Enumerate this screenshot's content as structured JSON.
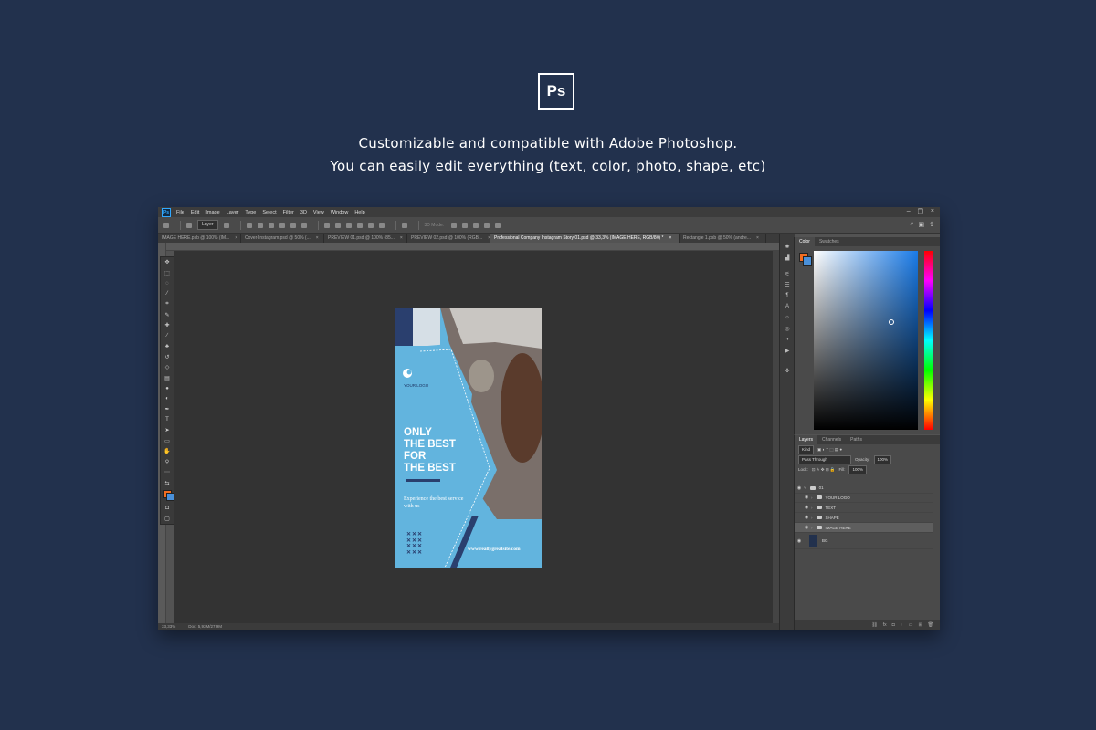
{
  "badge": {
    "text": "Ps"
  },
  "headline": {
    "line1": "Customizable and compatible with Adobe Photoshop.",
    "line2": "You can easily edit everything (text, color, photo, shape, etc)"
  },
  "ps_window": {
    "menu": [
      "File",
      "Edit",
      "Image",
      "Layer",
      "Type",
      "Select",
      "Filter",
      "3D",
      "View",
      "Window",
      "Help"
    ],
    "options_bar": {
      "layer_select": "Layer",
      "threed_mode": "3D Mode:"
    },
    "tabs": [
      {
        "label": "IMAGE HERE.psb @ 100% (IM...",
        "close": "×"
      },
      {
        "label": "Cover-Instagram.psd @ 50% (...",
        "close": "×"
      },
      {
        "label": "PREVIEW 01.psd @ 100% (85...",
        "close": "×"
      },
      {
        "label": "PREVIEW 02.psd @ 100% (RGB...",
        "close": "×"
      },
      {
        "label": "Professional Company Instagram Story 01.psd @ 33,3% (IMAGE HERE, RGB/8#) *",
        "close": "×"
      },
      {
        "label": "Rectangle 1.psb @ 50% (andre...",
        "close": "×"
      }
    ],
    "status": {
      "zoom": "33,33%",
      "doc": "Doc: 5,93M/27,9M"
    },
    "color_panel": {
      "tabs": [
        "Color",
        "Swatches"
      ]
    },
    "layers_panel": {
      "tabs": [
        "Layers",
        "Channels",
        "Paths"
      ],
      "kind": "Kind",
      "blend": "Pass Through",
      "opacity_label": "Opacity:",
      "opacity": "100%",
      "lock_label": "Lock:",
      "fill_label": "Fill:",
      "fill": "100%",
      "layers": [
        "01",
        "YOUR LOGO",
        "TEXT",
        "SHAPE",
        "IMAGE HERE",
        "BG"
      ]
    }
  },
  "document": {
    "logo_text": "YOUR LOGO",
    "headline": [
      "ONLY",
      "THE BEST",
      "FOR",
      "THE BEST"
    ],
    "subtext": "Experience the best service with us",
    "url": "www.reallygreatsite.com",
    "x_rows": [
      "✕✕✕",
      "✕✕✕",
      "✕✕✕",
      "✕✕✕"
    ]
  },
  "colors": {
    "background": "#22314d",
    "doc_blue": "#62b4de",
    "doc_navy": "#2a3f6e",
    "accent_orange": "#f26d21"
  }
}
